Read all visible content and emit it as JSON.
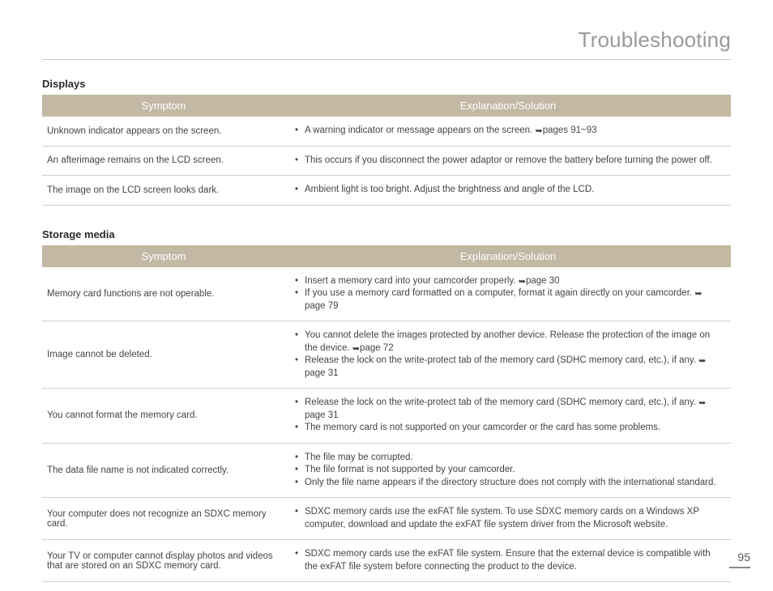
{
  "page_title": "Troubleshooting",
  "page_number": "95",
  "columns": {
    "symptom": "Symptom",
    "solution": "Explanation/Solution"
  },
  "ref_glyph": "➥",
  "sections": [
    {
      "heading": "Displays",
      "rows": [
        {
          "symptom": "Unknown indicator appears on the screen.",
          "solutions": [
            {
              "text": "A warning indicator or message appears on the screen. ",
              "ref": "pages 91~93"
            }
          ]
        },
        {
          "symptom": "An afterimage remains on the LCD screen.",
          "solutions": [
            {
              "text": "This occurs if you disconnect the power adaptor or remove the battery before turning the power off."
            }
          ]
        },
        {
          "symptom": "The image on the LCD screen looks dark.",
          "solutions": [
            {
              "text": "Ambient light is too bright. Adjust the brightness and angle of the LCD."
            }
          ]
        }
      ]
    },
    {
      "heading": "Storage media",
      "rows": [
        {
          "symptom": "Memory card functions are not operable.",
          "solutions": [
            {
              "text": "Insert a memory card into your camcorder properly. ",
              "ref": "page 30"
            },
            {
              "text": "If you use a memory card formatted on a computer, format it again directly on your camcorder. ",
              "ref": "page 79"
            }
          ]
        },
        {
          "symptom": "Image cannot be deleted.",
          "solutions": [
            {
              "text": "You cannot delete the images protected by another device. Release the protection of the image on the device. ",
              "ref": "page 72"
            },
            {
              "text": "Release the lock on the write-protect tab of the memory card (SDHC memory card, etc.), if any. ",
              "ref": "page 31"
            }
          ]
        },
        {
          "symptom": "You cannot format the memory card.",
          "solutions": [
            {
              "text": "Release the lock on the write-protect tab of the memory card (SDHC memory card, etc.), if any. ",
              "ref": "page 31"
            },
            {
              "text": "The memory card is not supported on your camcorder or the card has some problems."
            }
          ]
        },
        {
          "symptom": "The data file name is not indicated correctly.",
          "solutions": [
            {
              "text": "The file may be corrupted."
            },
            {
              "text": "The file format is not supported by your camcorder."
            },
            {
              "text": "Only the file name appears if the directory structure does not comply with the international standard."
            }
          ]
        },
        {
          "symptom": "Your computer does not recognize an SDXC memory card.",
          "solutions": [
            {
              "text": "SDXC memory cards use the exFAT file system. To use SDXC memory cards on a Windows XP computer, download and update the exFAT file system driver from the Microsoft website."
            }
          ]
        },
        {
          "symptom": "Your TV or computer cannot display photos and videos that are stored on an SDXC memory card.",
          "solutions": [
            {
              "text": "SDXC memory cards use the exFAT file system. Ensure that the external device is compatible with the exFAT file system before connecting the product to the device."
            }
          ]
        }
      ]
    }
  ]
}
